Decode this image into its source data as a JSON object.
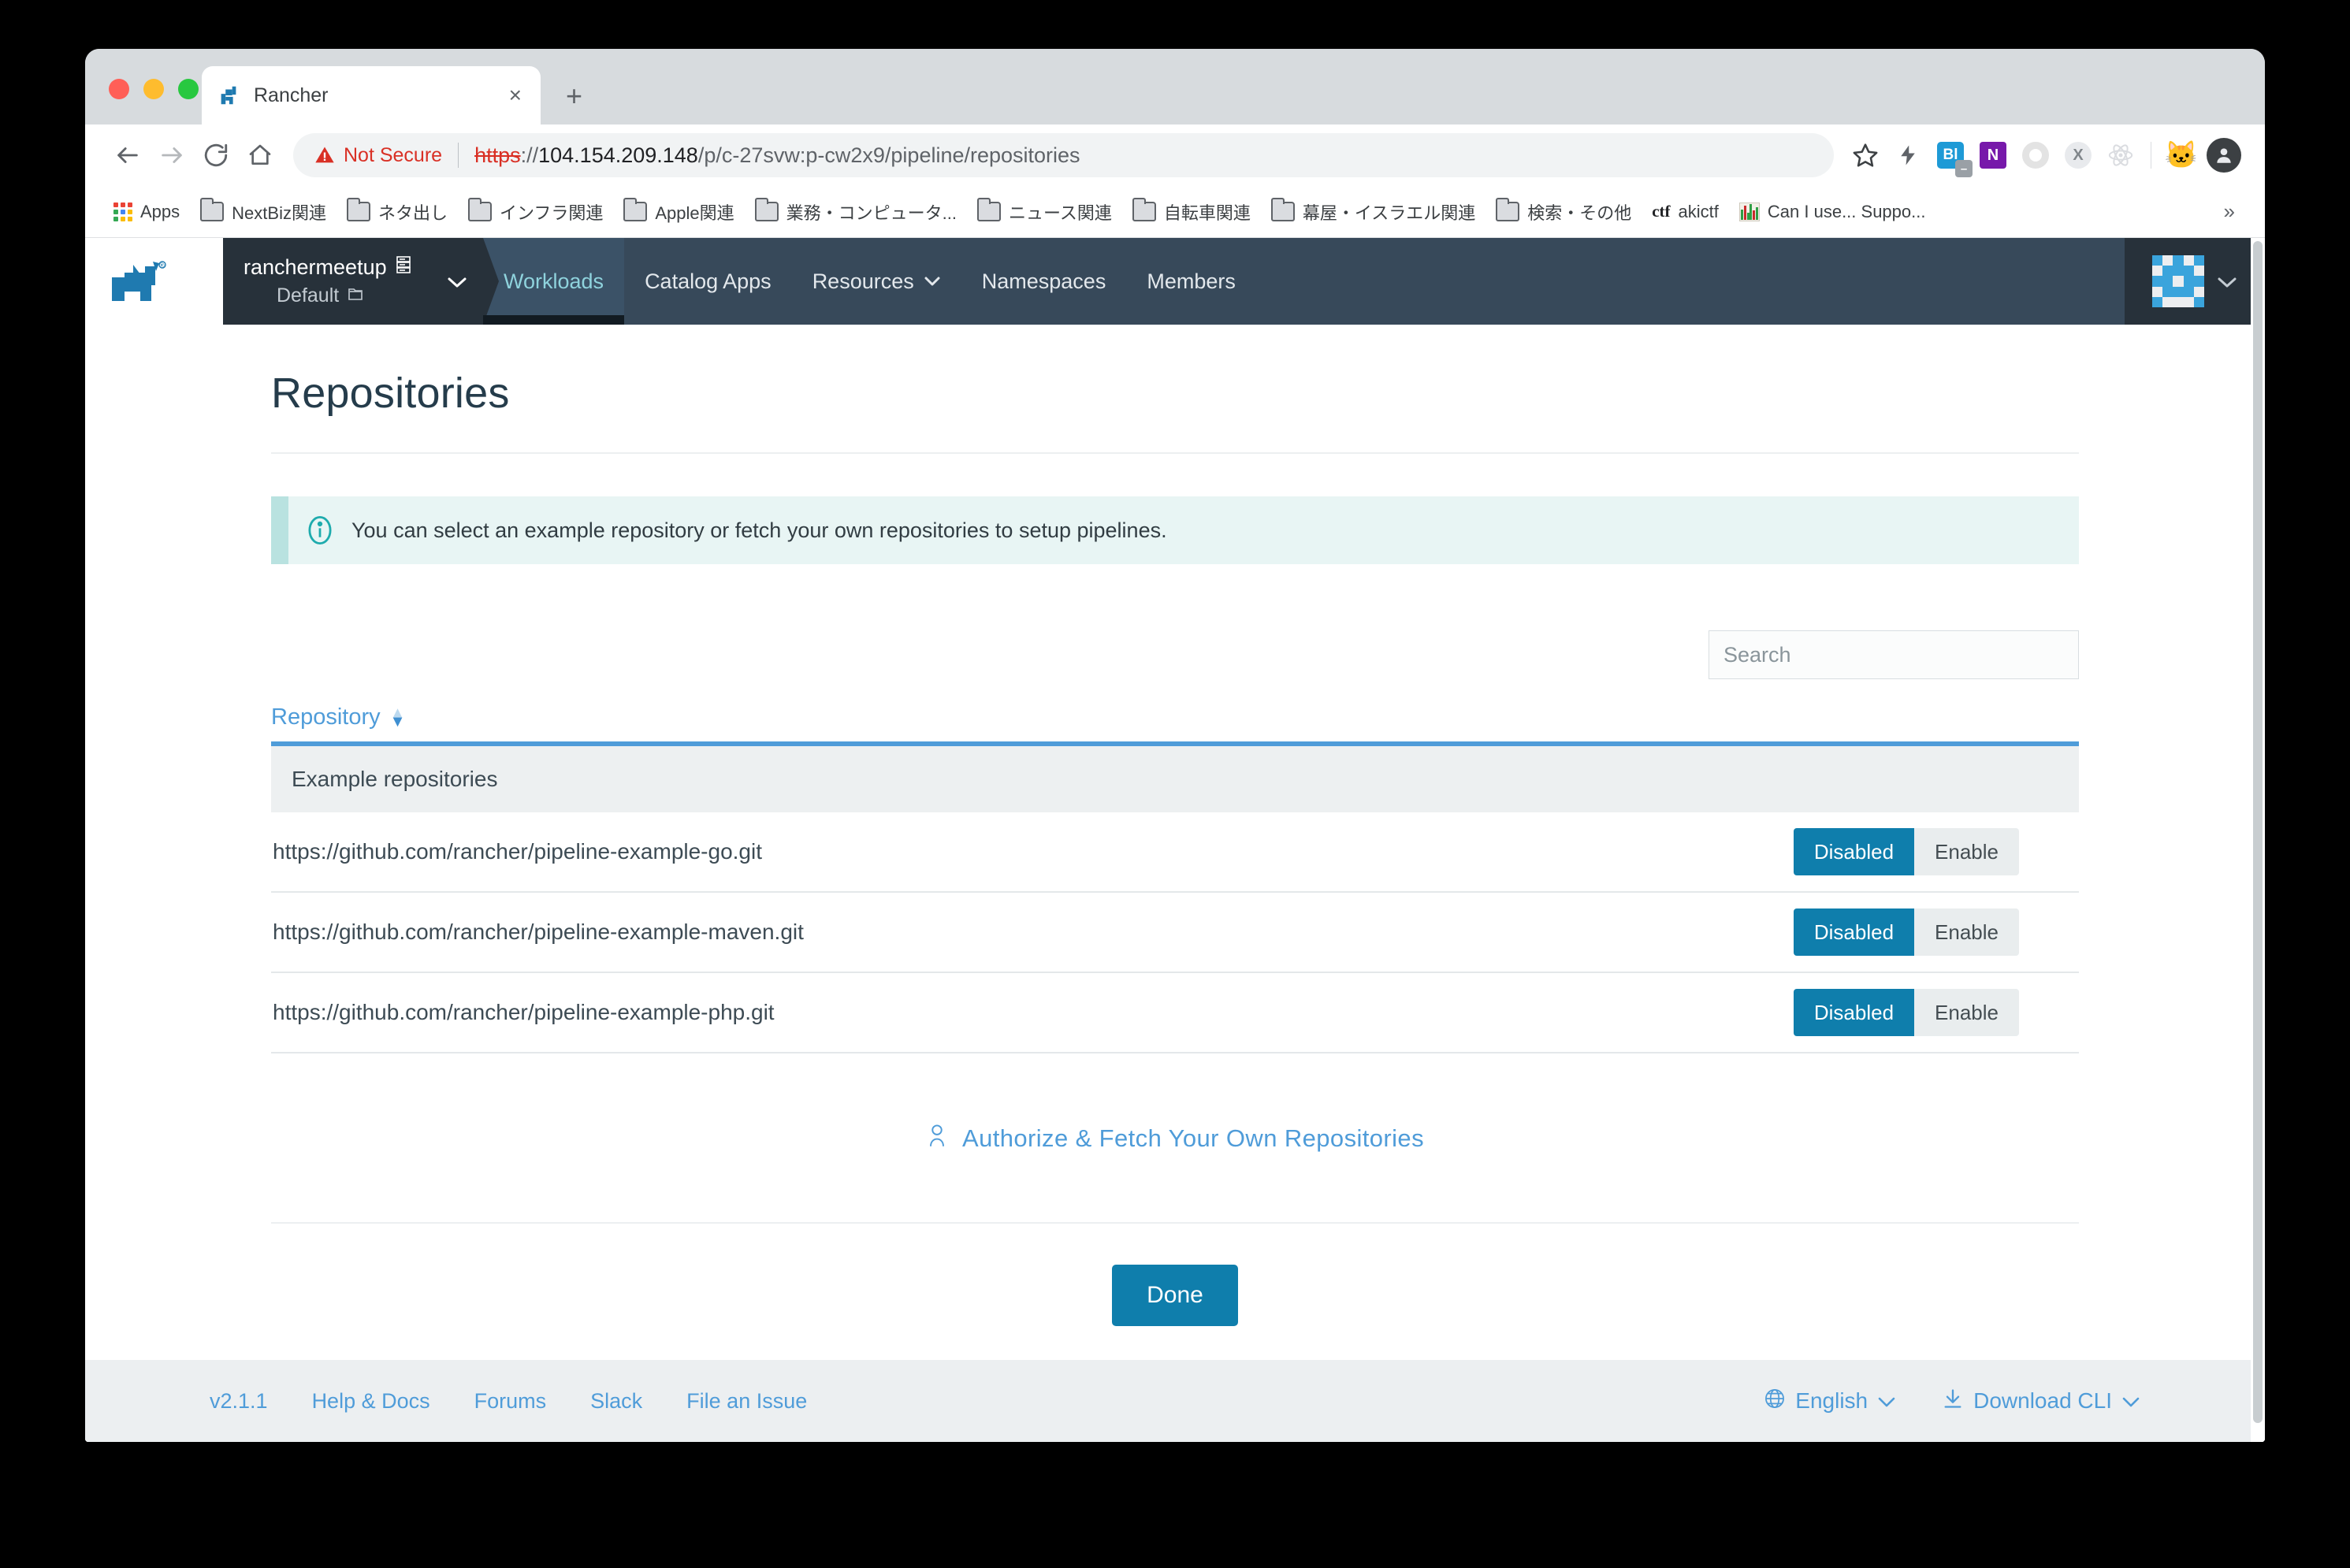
{
  "browser": {
    "tab": {
      "title": "Rancher",
      "close_label": "×"
    },
    "new_tab_label": "+",
    "security_label": "Not Secure",
    "url": {
      "scheme": "https",
      "separator": "://",
      "host": "104.154.209.148",
      "path": "/p/c-27svw:p-cw2x9/pipeline/repositories",
      "full": "https://104.154.209.148/p/c-27svw:p-cw2x9/pipeline/repositories"
    },
    "extensions": [
      {
        "name": "bookmark-star-icon",
        "label": ""
      },
      {
        "name": "lightning-icon",
        "label": ""
      },
      {
        "name": "bl-extension-icon",
        "label": "Bl"
      },
      {
        "name": "onenote-icon",
        "label": "N"
      },
      {
        "name": "ring-extension-icon",
        "label": ""
      },
      {
        "name": "x-extension-icon",
        "label": "X"
      },
      {
        "name": "react-devtools-icon",
        "label": ""
      },
      {
        "name": "cat-emoji-icon",
        "label": "🐱"
      },
      {
        "name": "profile-avatar",
        "label": ""
      }
    ],
    "bookmarks": [
      {
        "label": "Apps",
        "icon": "apps-grid-icon"
      },
      {
        "label": "NextBiz関連",
        "icon": "folder-icon"
      },
      {
        "label": "ネタ出し",
        "icon": "folder-icon"
      },
      {
        "label": "インフラ関連",
        "icon": "folder-icon"
      },
      {
        "label": "Apple関連",
        "icon": "folder-icon"
      },
      {
        "label": "業務・コンピュータ...",
        "icon": "folder-icon"
      },
      {
        "label": "ニュース関連",
        "icon": "folder-icon"
      },
      {
        "label": "自転車関連",
        "icon": "folder-icon"
      },
      {
        "label": "幕屋・イスラエル関連",
        "icon": "folder-icon"
      },
      {
        "label": "検索・その他",
        "icon": "folder-icon"
      },
      {
        "label": "akictf",
        "icon": "ctf-icon"
      },
      {
        "label": "Can I use... Suppo...",
        "icon": "chart-icon"
      }
    ],
    "bookmarks_overflow": "»"
  },
  "app": {
    "cluster": {
      "name": "ranchermeetup",
      "project": "Default",
      "caret": "⌄"
    },
    "nav": [
      {
        "label": "Workloads",
        "active": true,
        "has_caret": false
      },
      {
        "label": "Catalog Apps",
        "active": false,
        "has_caret": false
      },
      {
        "label": "Resources",
        "active": false,
        "has_caret": true
      },
      {
        "label": "Namespaces",
        "active": false,
        "has_caret": false
      },
      {
        "label": "Members",
        "active": false,
        "has_caret": false
      }
    ],
    "user_caret": "⌄"
  },
  "main": {
    "title": "Repositories",
    "banner": "You can select an example repository or fetch your own repositories to setup pipelines.",
    "search": {
      "value": "",
      "placeholder": "Search"
    },
    "table": {
      "sort_column": "Repository",
      "group_label": "Example repositories",
      "rows": [
        {
          "url": "https://github.com/rancher/pipeline-example-go.git",
          "state_label": "Disabled",
          "action_label": "Enable"
        },
        {
          "url": "https://github.com/rancher/pipeline-example-maven.git",
          "state_label": "Disabled",
          "action_label": "Enable"
        },
        {
          "url": "https://github.com/rancher/pipeline-example-php.git",
          "state_label": "Disabled",
          "action_label": "Enable"
        }
      ]
    },
    "fetch_link": "Authorize & Fetch Your Own Repositories",
    "done_label": "Done"
  },
  "footer": {
    "links": [
      "v2.1.1",
      "Help & Docs",
      "Forums",
      "Slack",
      "File an Issue"
    ],
    "language": "English",
    "download": "Download CLI",
    "caret": "⌄"
  },
  "colors": {
    "accent_blue": "#4f9cd9",
    "primary_button": "#0f7eac",
    "nav_dark": "#27313a",
    "nav_slate": "#37495a",
    "banner_bg": "#e8f5f4",
    "danger_red": "#d93025"
  }
}
